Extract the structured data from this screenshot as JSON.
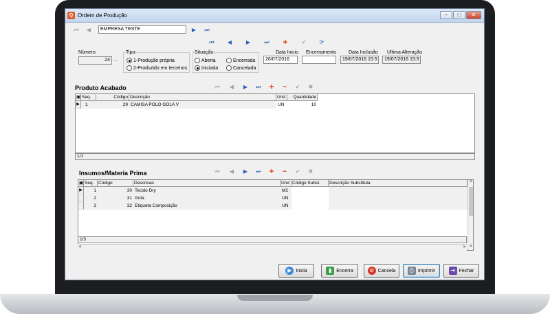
{
  "window": {
    "title": "Ordem de Produção"
  },
  "company": {
    "value": "EMPRESA TESTE"
  },
  "header": {
    "numero_label": "Número",
    "numero_value": "24",
    "tipo_label": "Tipo:",
    "tipo_options": [
      "1-Produção própria",
      "2-Produzido em terceiros"
    ],
    "situacao_label": "Situação:",
    "situacao_options": [
      "Aberta",
      "Encerrada",
      "Iniciada",
      "Cancelada"
    ],
    "data_inicio_label": "Data Inicio",
    "data_inicio_value": "26/07/2016",
    "encerramento_label": "Encerramento",
    "encerramento_value": "",
    "data_inclusao_label": "Data Inclusão",
    "data_inclusao_value": "19/07/2016 15:5",
    "ultima_alteracao_label": "Ultima Alteração",
    "ultima_alteracao_value": "19/07/2016 15:5"
  },
  "produto": {
    "title": "Produto Acabado",
    "columns": [
      "Seq.",
      "Código",
      "Descrição",
      "Und",
      "Quantidade"
    ],
    "rows": [
      {
        "seq": "1",
        "codigo": "29",
        "descricao": "CAMISA POLO GOLA V",
        "und": "UN",
        "quantidade": "10"
      }
    ],
    "status": "1/1"
  },
  "insumos": {
    "title": "Insumos/Materia Prima",
    "columns": [
      "Seq.",
      "Código",
      "Descricao",
      "Und",
      "Código Subst.",
      "Descrição Substituta"
    ],
    "rows": [
      {
        "seq": "1",
        "codigo": "30",
        "descricao": "Tecido Dry",
        "und": "M2",
        "cod_subst": "",
        "desc_subst": ""
      },
      {
        "seq": "2",
        "codigo": "31",
        "descricao": "Gola",
        "und": "UN",
        "cod_subst": "",
        "desc_subst": ""
      },
      {
        "seq": "3",
        "codigo": "32",
        "descricao": "Etiqueta Composição",
        "und": "UN",
        "cod_subst": "",
        "desc_subst": ""
      }
    ],
    "status": "1/3"
  },
  "buttons": {
    "inicia": "Inicia",
    "encerra": "Encerra",
    "cancela": "Cancela",
    "imprimir": "Imprimir",
    "fechar": "Fechar"
  },
  "icons": {
    "first": "⏮",
    "prior": "◀",
    "next": "▶",
    "last": "⏭",
    "insert": "✚",
    "delete": "━",
    "post": "✔",
    "cancel": "✖",
    "refresh": "⟳",
    "ellipsis": "..."
  },
  "colors": {
    "accent_blue": "#2a62b8",
    "insert_red": "#e0511f",
    "title_bar": "#c2d6ee"
  }
}
